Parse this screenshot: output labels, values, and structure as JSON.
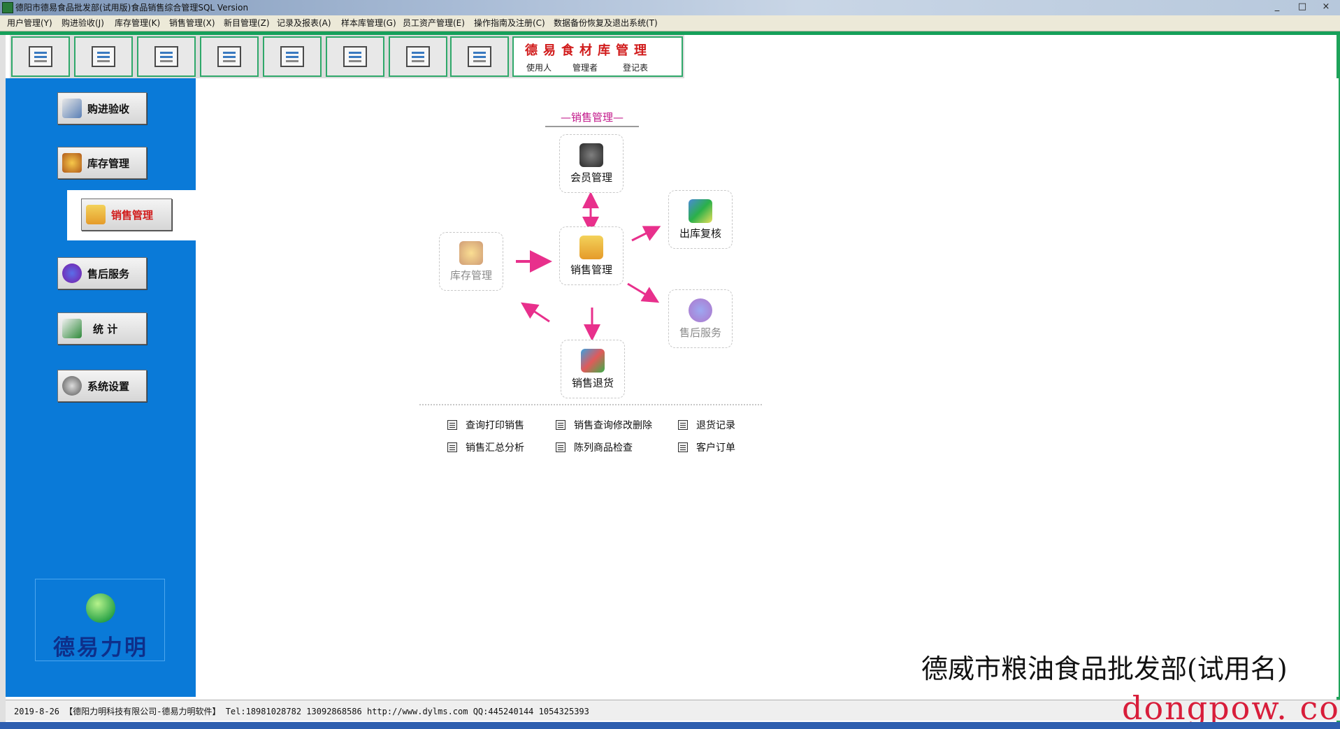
{
  "window": {
    "title": "德阳市德易食品批发部(试用版)食品销售综合管理SQL Version",
    "controls": [
      "_",
      "□",
      "×"
    ]
  },
  "menu": [
    "用户管理(Y)",
    "购进验收(J)",
    "库存管理(K)",
    "销售管理(X)",
    "新目管理(Z)",
    "记录及报表(A)",
    "样本库管理(G)",
    "员工资产管理(E)",
    "操作指南及注册(C)",
    "数据备份恢复及退出系统(T)"
  ],
  "toolbar": {
    "buttons": [
      "refresh-icon",
      "document-icon",
      "window-icon",
      "report-icon",
      "tools-icon",
      "image-icon",
      "book-icon",
      "exit-icon"
    ],
    "logo_title": "德易食材库管理",
    "logo_items": [
      "使用人",
      "管理者",
      "登记表"
    ]
  },
  "sidebar": {
    "items": [
      "购进验收",
      "库存管理",
      "销售管理",
      "售后服务",
      "统 计",
      "系统设置"
    ],
    "active": "销售管理",
    "brand": "德易力明"
  },
  "diagram": {
    "title": "—销售管理—",
    "nodes": {
      "member": "会员管理",
      "stock": "库存管理",
      "sales": "销售管理",
      "review": "出库复核",
      "aftersale": "售后服务",
      "returns": "销售退货"
    }
  },
  "links": [
    "查询打印销售",
    "销售查询修改删除",
    "退货记录",
    "销售汇总分析",
    "陈列商品检查",
    "客户订单"
  ],
  "company": "德威市粮油食品批发部(试用名)",
  "status": "2019-8-26 【德阳力明科技有限公司-德易力明软件】 Tel:18981028782 13092868586 http://www.dylms.com QQ:445240144 1054325393",
  "watermark": "dongpow. com",
  "colors": {
    "sidebar": "#0a7ad8",
    "accent_green": "#15a05a",
    "arrow": "#e8308c",
    "title_red": "#d11c1c"
  }
}
